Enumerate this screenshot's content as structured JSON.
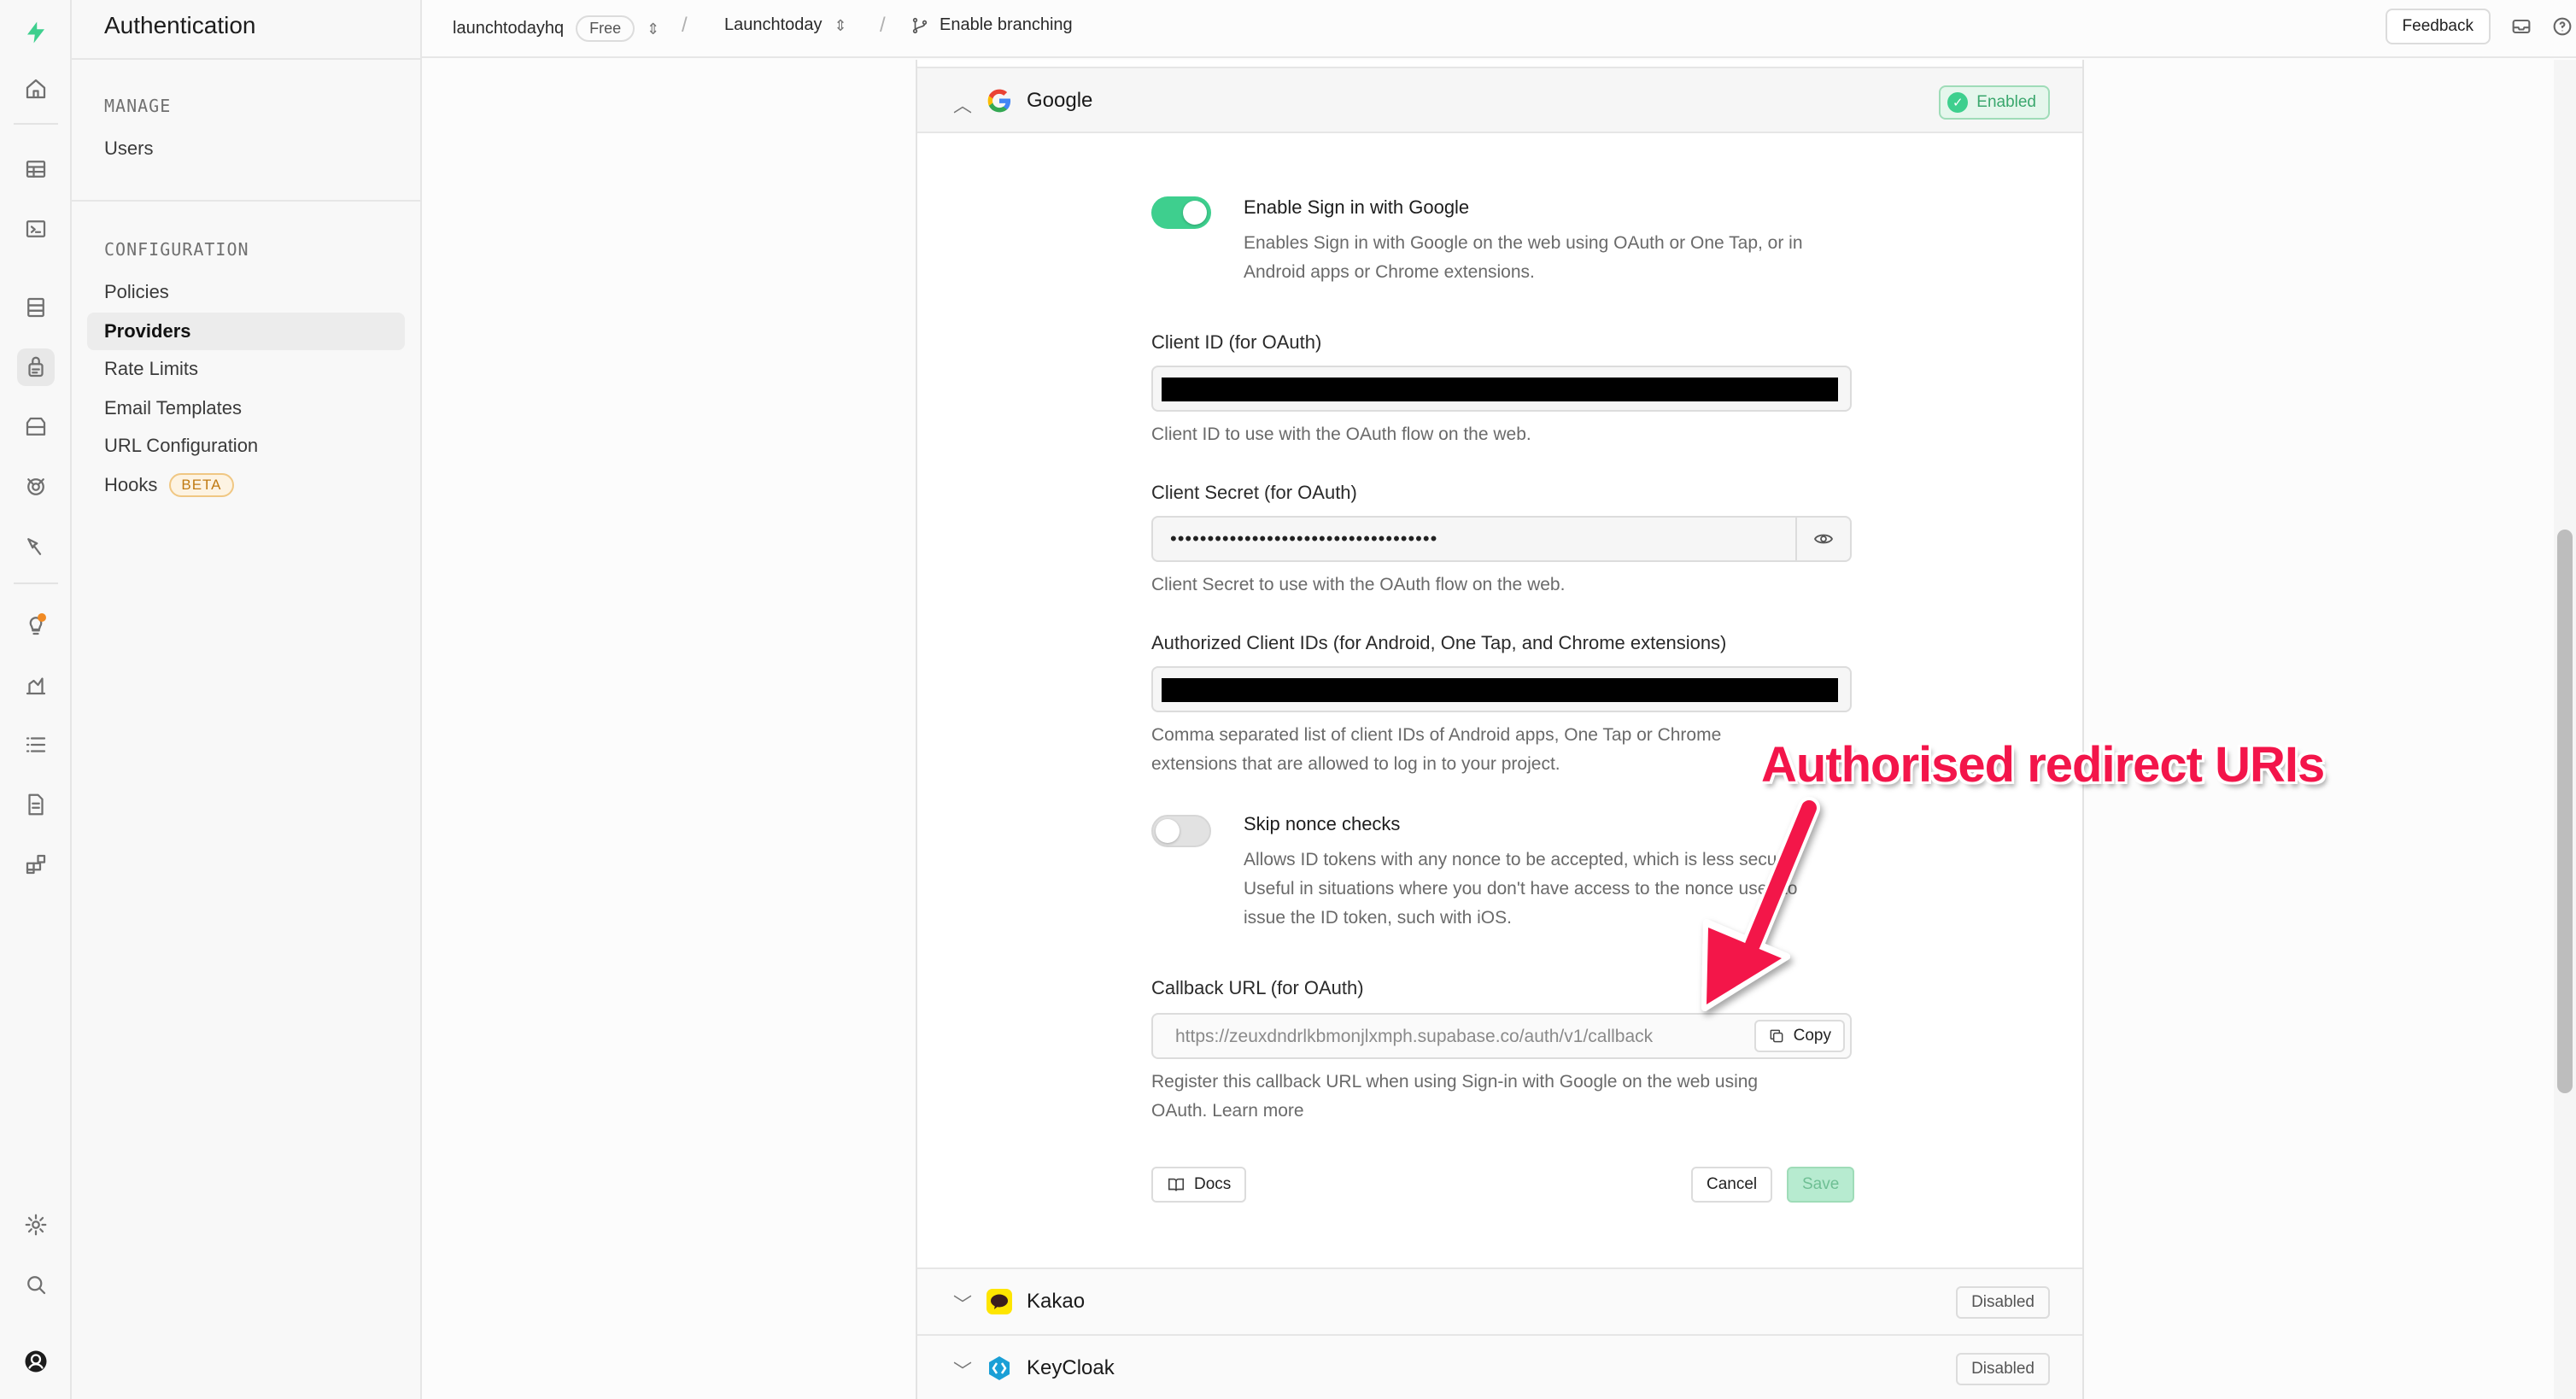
{
  "sidebar_menu": {
    "title": "Authentication",
    "manage_heading": "MANAGE",
    "manage_items": [
      "Users"
    ],
    "config_heading": "CONFIGURATION",
    "config_items": [
      "Policies",
      "Providers",
      "Rate Limits",
      "Email Templates",
      "URL Configuration",
      "Hooks"
    ],
    "active_item": "Providers",
    "hooks_badge": "BETA"
  },
  "rail_icons": [
    "supabase-logo-icon",
    "home-icon",
    "table-editor-icon",
    "sql-editor-icon",
    "database-icon",
    "authentication-icon",
    "storage-icon",
    "realtime-icon",
    "edge-functions-icon",
    "advisors-icon",
    "reports-icon",
    "logs-icon",
    "api-docs-icon",
    "integrations-icon",
    "settings-icon",
    "search-icon",
    "user-avatar-icon"
  ],
  "topbar": {
    "org": "launchtodayhq",
    "plan": "Free",
    "project": "Launchtoday",
    "branch": "Enable branching",
    "feedback": "Feedback"
  },
  "google": {
    "name": "Google",
    "status": "Enabled",
    "enable_title": "Enable Sign in with Google",
    "enable_desc_1": "Enables Sign in with Google on the web using OAuth or One Tap, or in",
    "enable_desc_2": "Android apps or Chrome extensions.",
    "enabled": true,
    "client_id_label": "Client ID (for OAuth)",
    "client_id_help": "Client ID to use with the OAuth flow on the web.",
    "client_secret_label": "Client Secret (for OAuth)",
    "client_secret_value": "••••••••••••••••••••••••••••••••••••",
    "client_secret_help": "Client Secret to use with the OAuth flow on the web.",
    "authorized_label": "Authorized Client IDs (for Android, One Tap, and Chrome extensions)",
    "authorized_help_1": "Comma separated list of client IDs of Android apps, One Tap or Chrome",
    "authorized_help_2": "extensions that are allowed to log in to your project.",
    "skip_nonce_title": "Skip nonce checks",
    "skip_nonce_enabled": false,
    "skip_nonce_desc_1": "Allows ID tokens with any nonce to be accepted, which is less secure.",
    "skip_nonce_desc_2": "Useful in situations where you don't have access to the nonce used to",
    "skip_nonce_desc_3": "issue the ID token, such with iOS.",
    "callback_label": "Callback URL (for OAuth)",
    "callback_value": "https://zeuxdndrlkbmonjlxmph.supabase.co/auth/v1/callback",
    "copy_label": "Copy",
    "callback_help_1": "Register this callback URL when using Sign-in with Google on the web using",
    "callback_help_2": "OAuth. Learn more",
    "docs_label": "Docs",
    "cancel_label": "Cancel",
    "save_label": "Save"
  },
  "providers_below": [
    {
      "name": "Kakao",
      "status": "Disabled"
    },
    {
      "name": "KeyCloak",
      "status": "Disabled"
    }
  ],
  "annotation": {
    "text": "Authorised redirect URIs",
    "color": "#f3154a"
  },
  "colors": {
    "brand_green": "#3ecf8e",
    "enabled_badge_bg": "#e5f6ec",
    "beta_badge": "#c07a12"
  }
}
